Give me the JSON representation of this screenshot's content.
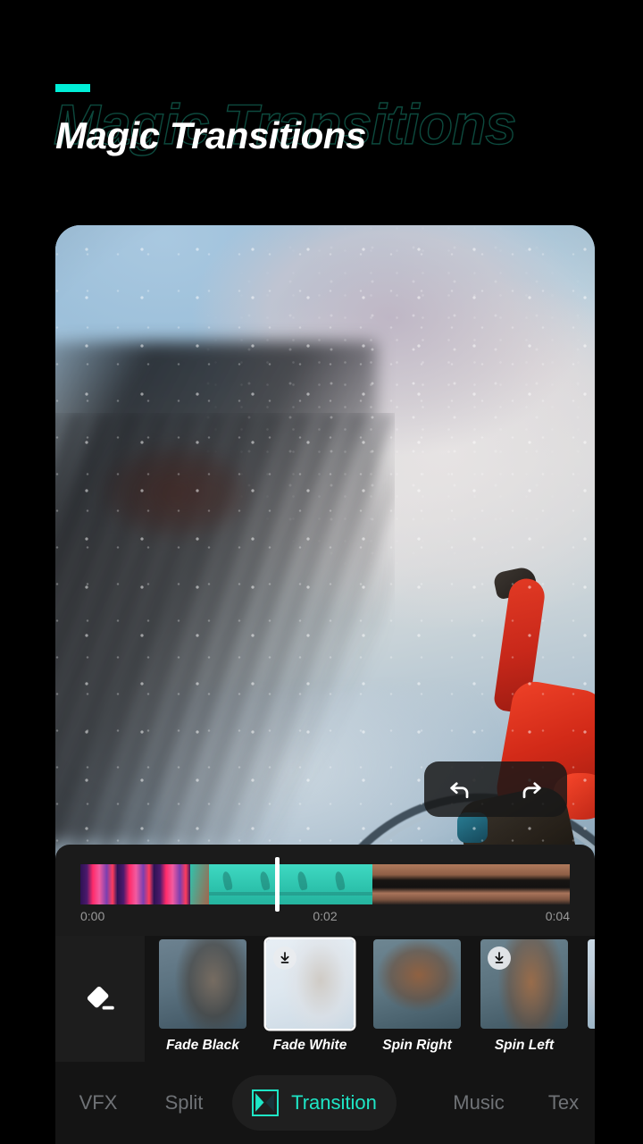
{
  "header": {
    "title": "Magic Transitions",
    "ghost_title": "Magic Transitions",
    "accent_color": "#00efd8"
  },
  "preview": {
    "scene_description": "Snowboarder in red jacket riding a rail with snow spray",
    "undo_icon": "undo-arrow-icon",
    "redo_icon": "redo-arrow-icon"
  },
  "timeline": {
    "time_start": "0:00",
    "time_mid": "0:02",
    "time_end": "0:04",
    "playhead_position": "0:02",
    "clips": [
      {
        "name": "clip-1",
        "frames": 4,
        "style": "f-pink"
      },
      {
        "name": "clip-2",
        "frames": 5,
        "style": "f-teal"
      },
      {
        "name": "clip-3",
        "frames": 6,
        "style": "f-hands"
      }
    ]
  },
  "transitions": {
    "none_icon": "eraser-icon",
    "items": [
      {
        "label": "Fade Black",
        "thumb": "th-fadeblack",
        "selected": false,
        "download": false
      },
      {
        "label": "Fade White",
        "thumb": "th-fadewhite",
        "selected": true,
        "download": true
      },
      {
        "label": "Spin Right",
        "thumb": "th-spinright",
        "selected": false,
        "download": false
      },
      {
        "label": "Spin Left",
        "thumb": "th-spinleft",
        "selected": false,
        "download": true
      },
      {
        "label": "",
        "thumb": "th-cut",
        "selected": false,
        "download": true
      }
    ]
  },
  "tabbar": {
    "active_color": "#1ee6c6",
    "inactive_color": "#6f7276",
    "tabs": [
      {
        "label": "VFX",
        "active": false
      },
      {
        "label": "Split",
        "active": false
      },
      {
        "label": "Transition",
        "active": true
      },
      {
        "label": "Music",
        "active": false
      },
      {
        "label": "Tex",
        "active": false
      }
    ]
  }
}
